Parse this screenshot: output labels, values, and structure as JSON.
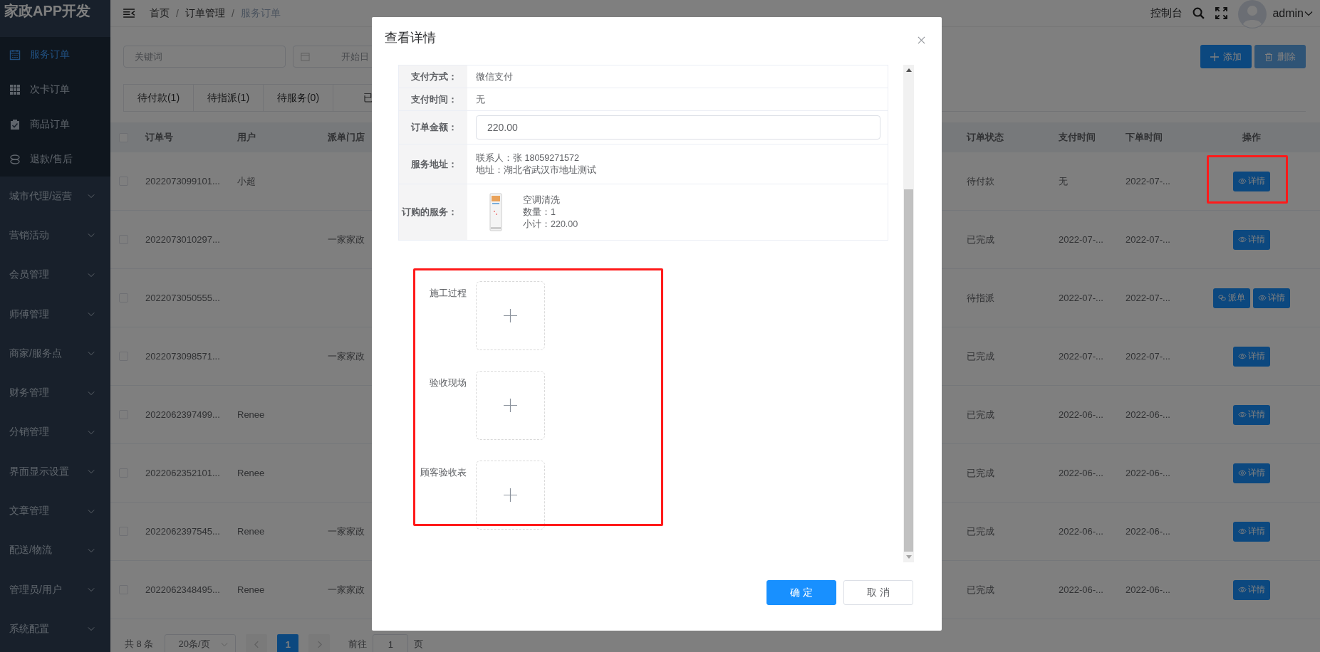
{
  "sidebar": {
    "logo": "家政APP开发",
    "items": [
      {
        "kind": "sub",
        "label": "服务订单",
        "selected": true
      },
      {
        "kind": "sub",
        "label": "次卡订单",
        "selected": false
      },
      {
        "kind": "sub",
        "label": "商品订单",
        "selected": false
      },
      {
        "kind": "sub",
        "label": "退款/售后",
        "selected": false
      },
      {
        "kind": "group",
        "label": "城市代理/运营",
        "selected": false
      },
      {
        "kind": "group",
        "label": "营销活动",
        "selected": false
      },
      {
        "kind": "group",
        "label": "会员管理",
        "selected": false
      },
      {
        "kind": "group",
        "label": "师傅管理",
        "selected": false
      },
      {
        "kind": "group",
        "label": "商家/服务点",
        "selected": false
      },
      {
        "kind": "group",
        "label": "财务管理",
        "selected": false
      },
      {
        "kind": "group",
        "label": "分销管理",
        "selected": false
      },
      {
        "kind": "group",
        "label": "界面显示设置",
        "selected": false
      },
      {
        "kind": "group",
        "label": "文章管理",
        "selected": false
      },
      {
        "kind": "group",
        "label": "配送/物流",
        "selected": false
      },
      {
        "kind": "group",
        "label": "管理员/用户",
        "selected": false
      },
      {
        "kind": "group",
        "label": "系统配置",
        "selected": false
      }
    ]
  },
  "header": {
    "breadcrumb": [
      "首页",
      "订单管理",
      "服务订单"
    ],
    "separator": "/",
    "console": "控制台",
    "user": "admin"
  },
  "toolbar": {
    "keyword": {
      "placeholder": "关键词"
    },
    "date": {
      "placeholder": "开始日"
    },
    "buttons": [
      {
        "kind": "add",
        "label": "添加",
        "disabled": false
      },
      {
        "kind": "delete",
        "label": "删除",
        "disabled": true
      }
    ]
  },
  "tabs": [
    {
      "label": "待付款(1)",
      "selected": false
    },
    {
      "label": "待指派(1)",
      "selected": false
    },
    {
      "label": "待服务(0)",
      "selected": false
    },
    {
      "label": "已",
      "selected": false
    }
  ],
  "table": {
    "select_all_checked": false,
    "columns": [
      "订单号",
      "用户",
      "派单门店",
      "订单状态",
      "支付时间",
      "下单时间",
      "操作"
    ],
    "rows": [
      {
        "checked": false,
        "order_no": "2022073099101...",
        "user": "小超",
        "store": "",
        "status": "待付款",
        "pay_time": "无",
        "order_time": "2022-07-...",
        "actions": [
          {
            "kind": "detail",
            "label": "详情"
          }
        ]
      },
      {
        "checked": false,
        "order_no": "2022073010297...",
        "user": "",
        "store": "一家家政",
        "status": "已完成",
        "pay_time": "2022-07-...",
        "order_time": "2022-07-...",
        "actions": [
          {
            "kind": "detail",
            "label": "详情"
          }
        ]
      },
      {
        "checked": false,
        "order_no": "2022073050555...",
        "user": "",
        "store": "",
        "status": "待指派",
        "pay_time": "2022-07-...",
        "order_time": "2022-07-...",
        "actions": [
          {
            "kind": "dispatch",
            "label": "派单"
          },
          {
            "kind": "detail",
            "label": "详情"
          }
        ]
      },
      {
        "checked": false,
        "order_no": "2022073098571...",
        "user": "",
        "store": "一家家政",
        "status": "已完成",
        "pay_time": "2022-07-...",
        "order_time": "2022-07-...",
        "actions": [
          {
            "kind": "detail",
            "label": "详情"
          }
        ]
      },
      {
        "checked": false,
        "order_no": "2022062397499...",
        "user": "Renee",
        "store": "",
        "status": "已完成",
        "pay_time": "2022-06-...",
        "order_time": "2022-06-...",
        "actions": [
          {
            "kind": "detail",
            "label": "详情"
          }
        ]
      },
      {
        "checked": false,
        "order_no": "2022062352101...",
        "user": "Renee",
        "store": "",
        "status": "已完成",
        "pay_time": "2022-06-...",
        "order_time": "2022-06-...",
        "actions": [
          {
            "kind": "detail",
            "label": "详情"
          }
        ]
      },
      {
        "checked": false,
        "order_no": "2022062397545...",
        "user": "Renee",
        "store": "一家家政",
        "status": "已完成",
        "pay_time": "2022-06-...",
        "order_time": "2022-06-...",
        "actions": [
          {
            "kind": "detail",
            "label": "详情"
          }
        ]
      },
      {
        "checked": false,
        "order_no": "2022062348495...",
        "user": "Renee",
        "store": "一家家政",
        "status": "已完成",
        "pay_time": "2022-06-...",
        "order_time": "2022-06-...",
        "actions": [
          {
            "kind": "detail",
            "label": "详情"
          }
        ]
      }
    ]
  },
  "pagination": {
    "total": "共 8 条",
    "page_size": "20条/页",
    "pages": [
      {
        "label": "1",
        "selected": true
      }
    ],
    "goto": "前往",
    "goto_value": "1",
    "goto_suffix": "页"
  },
  "dialog": {
    "title": "查看详情",
    "details": [
      {
        "kind": "text",
        "label": "支付方式：",
        "value": "微信支付"
      },
      {
        "kind": "text",
        "label": "支付时间：",
        "value": "无"
      },
      {
        "kind": "input",
        "label": "订单金额：",
        "value": "220.00"
      },
      {
        "kind": "lines",
        "label": "服务地址：",
        "lines": [
          "联系人：张 18059271572",
          "地址：湖北省武汉市地址测试"
        ]
      },
      {
        "kind": "service",
        "label": "订购的服务：",
        "lines": [
          "空调清洗",
          "数量：1",
          "小计：220.00"
        ]
      }
    ],
    "uploads": [
      "施工过程",
      "验收现场",
      "顾客验收表"
    ],
    "buttons": [
      {
        "kind": "primary",
        "label": "确 定"
      },
      {
        "kind": "default",
        "label": "取 消"
      }
    ]
  }
}
